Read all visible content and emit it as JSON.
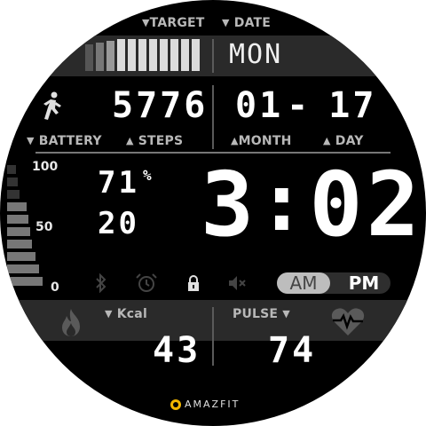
{
  "header": {
    "target_label": "TARGET",
    "date_label": "DATE",
    "day_of_week": "MON",
    "target_progress": 0.6
  },
  "activity": {
    "steps": "5776",
    "month": "01",
    "date_sep": "-",
    "day": "17",
    "battery_label": "BATTERY",
    "steps_label": "STEPS",
    "month_label": "MONTH",
    "day_label": "DAY"
  },
  "battery": {
    "scale_top": "100",
    "scale_mid": "50",
    "scale_bottom": "0",
    "percent": "71",
    "percent_unit": "%",
    "temperature": "20",
    "level": 0.71
  },
  "time": {
    "hour": "3",
    "colon": ":",
    "minute": "02",
    "am_label": "AM",
    "pm_label": "PM"
  },
  "status_icons": [
    "bluetooth-icon",
    "alarm-icon",
    "lock-icon",
    "mute-icon"
  ],
  "bottom": {
    "kcal_label": "Kcal",
    "kcal": "43",
    "pulse_label": "PULSE",
    "pulse": "74"
  },
  "brand": {
    "name": "AMAZFIT",
    "accent": "#f2b600"
  },
  "colors": {
    "background": "#000000",
    "label": "#b8b8b8",
    "digits": "#ffffff",
    "band": "#2a2a2a"
  }
}
